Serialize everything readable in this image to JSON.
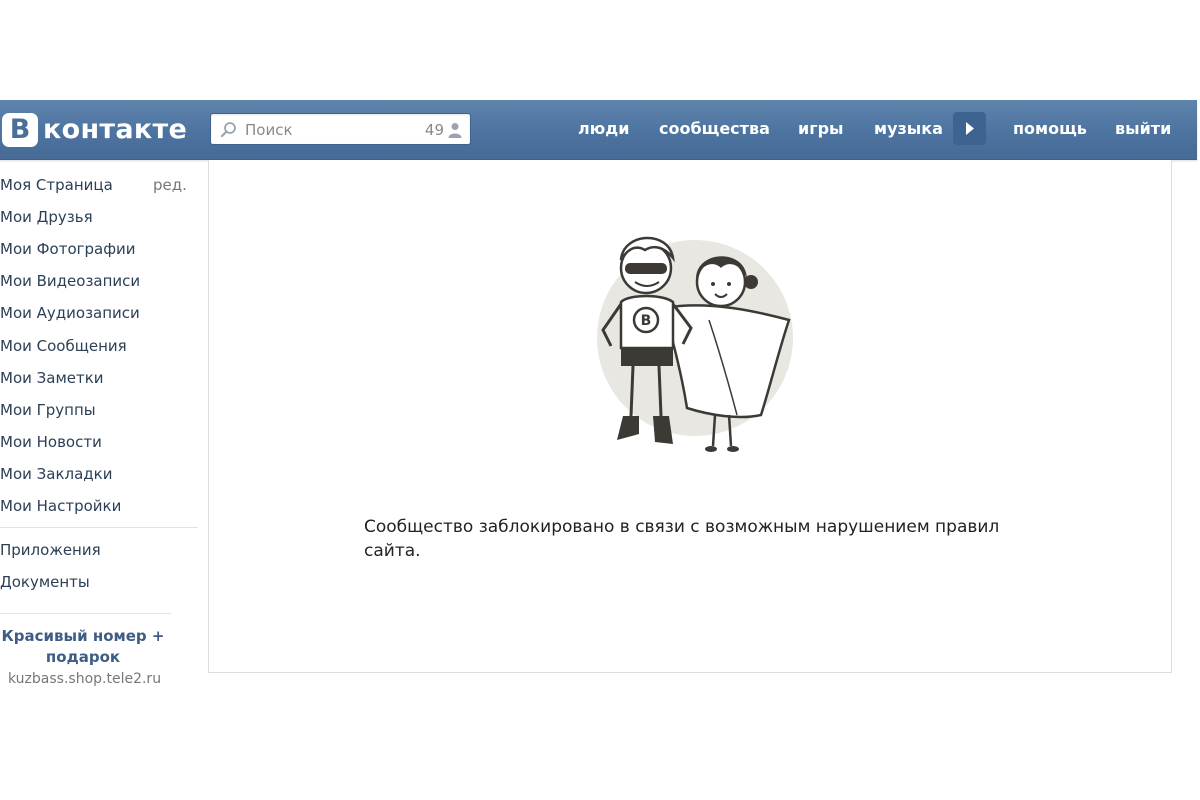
{
  "header": {
    "logo_badge": "B",
    "logo_text": "контакте",
    "search": {
      "placeholder": "Поиск",
      "count": "49"
    },
    "nav": {
      "people": "люди",
      "communities": "сообщества",
      "games": "игры",
      "music": "музыка",
      "help": "помощь",
      "logout": "выйти"
    },
    "colors": {
      "bar": "#4d73a0",
      "text": "#ffffff"
    }
  },
  "sidebar": {
    "items": [
      {
        "label": "Моя Страница"
      },
      {
        "label": "Мои Друзья"
      },
      {
        "label": "Мои Фотографии"
      },
      {
        "label": "Мои Видеозаписи"
      },
      {
        "label": "Мои Аудиозаписи"
      },
      {
        "label": "Мои Сообщения"
      },
      {
        "label": "Мои Заметки"
      },
      {
        "label": "Мои Группы"
      },
      {
        "label": "Мои Новости"
      },
      {
        "label": "Мои Закладки"
      },
      {
        "label": "Мои Настройки"
      }
    ],
    "edit_label": "ред.",
    "extra_items": [
      {
        "label": "Приложения"
      },
      {
        "label": "Документы"
      }
    ],
    "promo": {
      "title_line1": "Красивый номер +",
      "title_line2": "подарок",
      "url": "kuzbass.shop.tele2.ru"
    }
  },
  "content": {
    "illustration_badge": "B",
    "message_line1": "Сообщество заблокировано в связи с возможным нарушением правил",
    "message_line2": "сайта."
  }
}
